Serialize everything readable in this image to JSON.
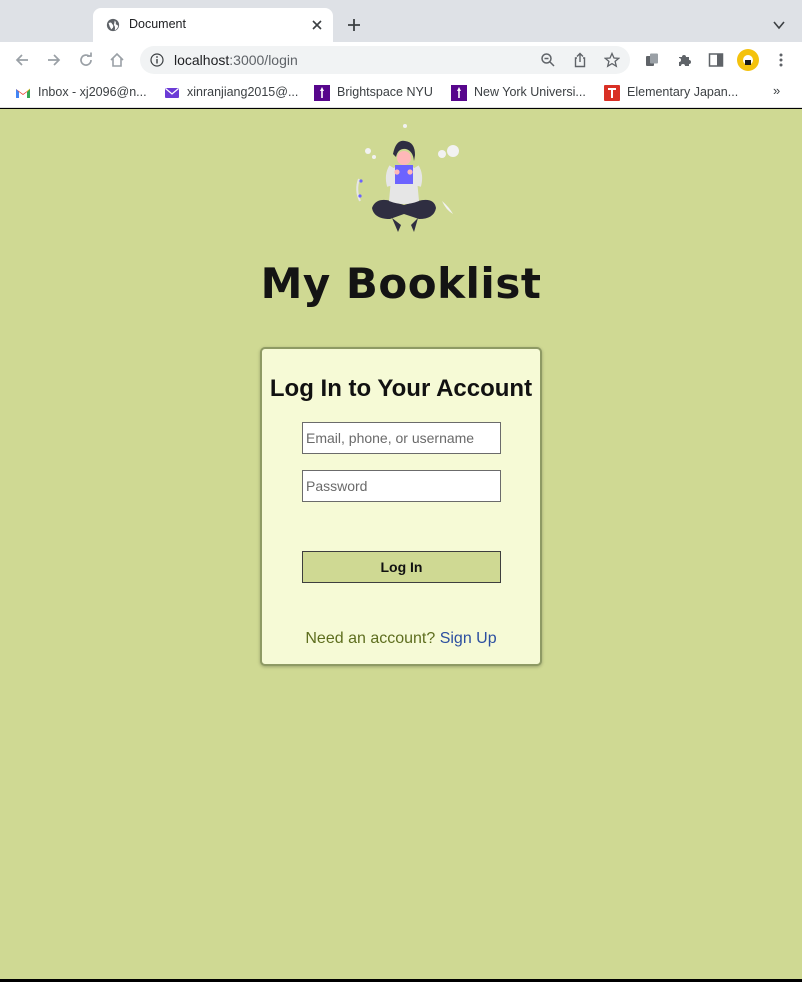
{
  "browser": {
    "tab": {
      "title": "Document",
      "favicon": "globe-icon"
    },
    "address_bar": {
      "host": "localhost",
      "path": ":3000/login"
    },
    "bookmarks": [
      {
        "label": "Inbox - xj2096@n...",
        "icon": "gmail-icon"
      },
      {
        "label": "xinranjiang2015@...",
        "icon": "mail-icon"
      },
      {
        "label": "Brightspace NYU",
        "icon": "nyu-icon"
      },
      {
        "label": "New York Universi...",
        "icon": "nyu-icon"
      },
      {
        "label": "Elementary Japan...",
        "icon": "t-icon"
      }
    ],
    "bookmarks_more": "»"
  },
  "page": {
    "brand_title": "My Booklist",
    "login_card": {
      "title": "Log In to Your Account",
      "identifier_placeholder": "Email, phone, or username",
      "password_placeholder": "Password",
      "submit_label": "Log In",
      "signup_prompt": "Need an account?",
      "signup_link": "Sign Up"
    }
  },
  "colors": {
    "page_background": "#cfd993",
    "card_background": "#f6fad6",
    "button_background": "#cfd993",
    "link": "#2c4fa0",
    "prompt_text": "#5e6e1f"
  }
}
